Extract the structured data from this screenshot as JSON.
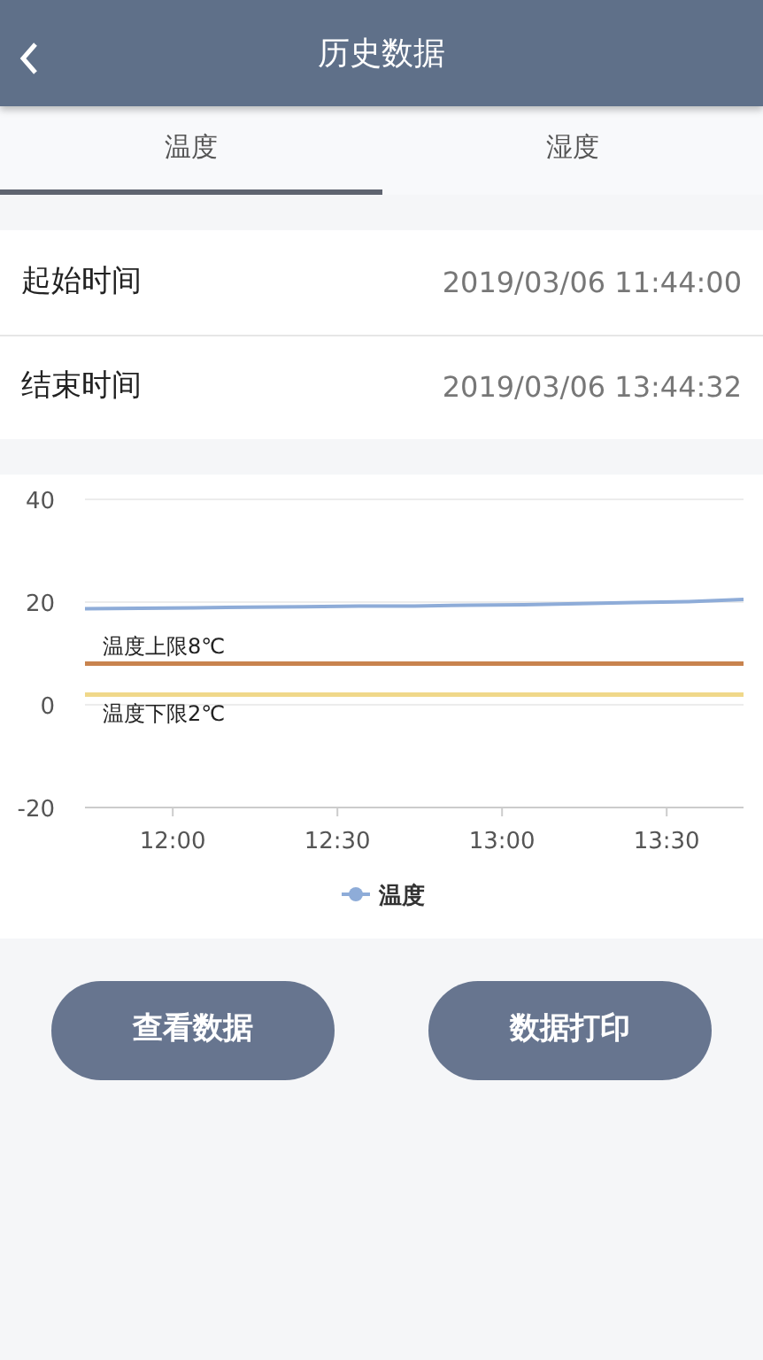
{
  "header": {
    "title": "历史数据"
  },
  "tabs": [
    {
      "label": "温度",
      "selected": true
    },
    {
      "label": "湿度",
      "selected": false
    }
  ],
  "time_range": [
    {
      "label": "起始时间",
      "value": "2019/03/06 11:44:00"
    },
    {
      "label": "结束时间",
      "value": "2019/03/06 13:44:32"
    }
  ],
  "chart_data": {
    "type": "line",
    "x": [
      704,
      714,
      724,
      734,
      744,
      754,
      764,
      774,
      784,
      794,
      804,
      814,
      824
    ],
    "series": [
      {
        "name": "温度",
        "color": "#8eacd8",
        "values": [
          18.7,
          18.8,
          18.9,
          19.0,
          19.1,
          19.2,
          19.2,
          19.4,
          19.5,
          19.7,
          19.9,
          20.1,
          20.5
        ]
      }
    ],
    "xlim": [
      704,
      824
    ],
    "ylim": [
      -20,
      40
    ],
    "xticks": [
      {
        "value": 720,
        "label": "12:00"
      },
      {
        "value": 750,
        "label": "12:30"
      },
      {
        "value": 780,
        "label": "13:00"
      },
      {
        "value": 810,
        "label": "13:30"
      }
    ],
    "yticks": [
      -20,
      0,
      20,
      40
    ],
    "ref_lines": [
      {
        "value": 8,
        "axis": "y",
        "label": "温度上限8℃",
        "color": "#c8834e"
      },
      {
        "value": 2,
        "axis": "y",
        "label": "温度下限2℃",
        "color": "#f0d88a"
      }
    ]
  },
  "buttons": [
    "查看数据",
    "数据打印"
  ]
}
